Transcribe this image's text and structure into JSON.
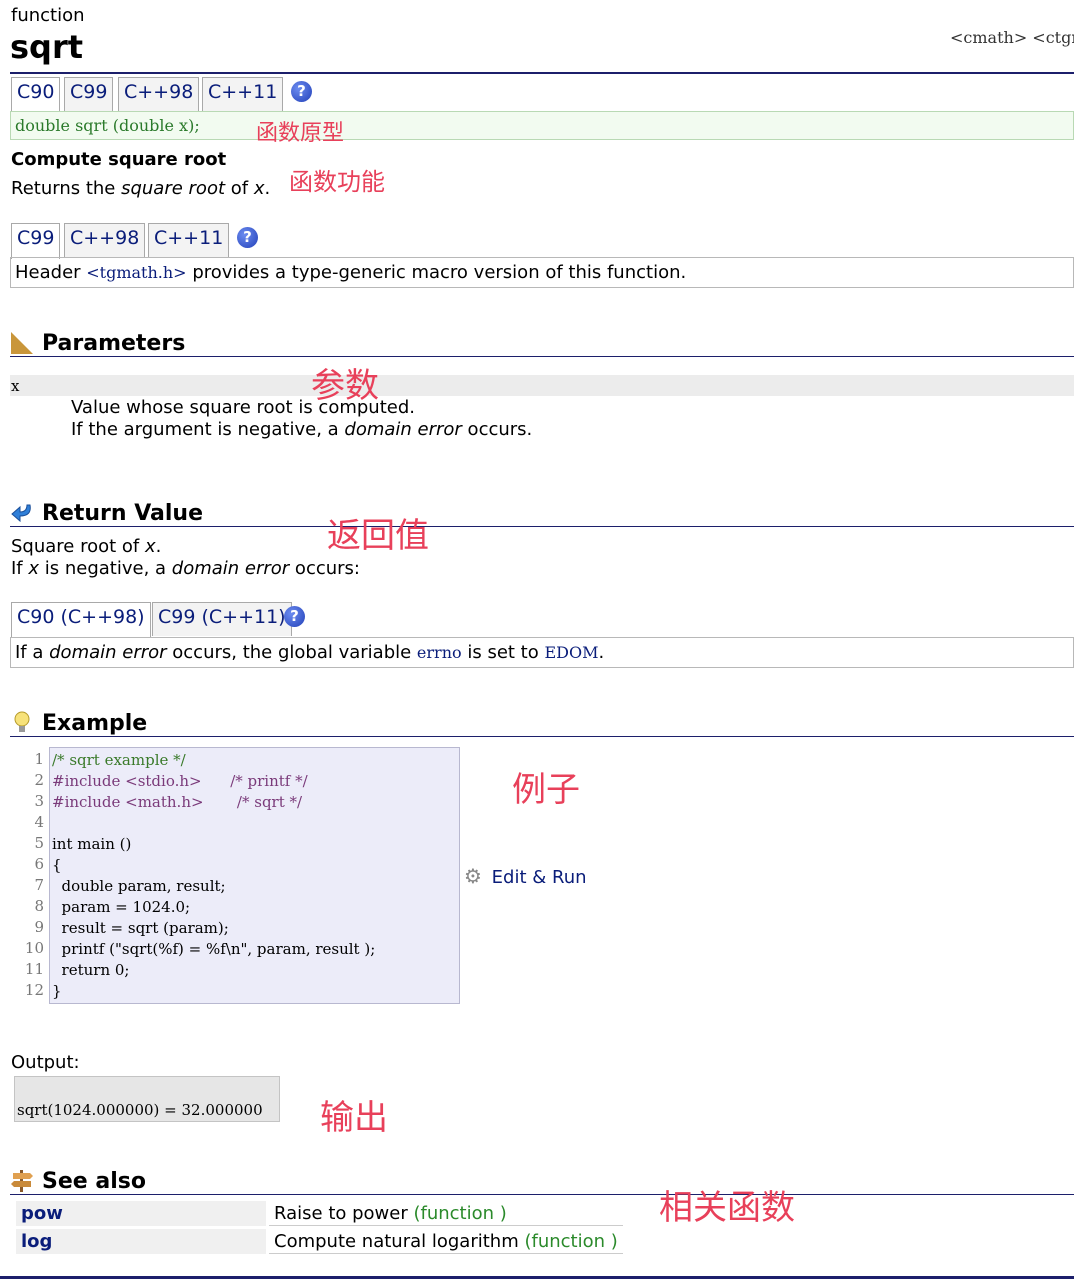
{
  "header": {
    "kind": "function",
    "name": "sqrt",
    "headers": "<cmath> <ctgma"
  },
  "proto_tabs": [
    "C90",
    "C99",
    "C++98",
    "C++11"
  ],
  "prototype": "double sqrt (double x);",
  "summary": {
    "title": "Compute square root",
    "text_pre": "Returns the ",
    "text_em": "square root",
    "text_mid": " of ",
    "text_var": "x",
    "text_post": "."
  },
  "generic_tabs": [
    "C99",
    "C++98",
    "C++11"
  ],
  "generic_note": {
    "pre": "Header ",
    "code": "<tgmath.h>",
    "post": " provides a type-generic macro version of this function."
  },
  "parameters": {
    "title": "Parameters",
    "param_name": "x",
    "line1": "Value whose square root is computed.",
    "line2_pre": "If the argument is negative, a ",
    "line2_em": "domain error",
    "line2_post": " occurs."
  },
  "return_value": {
    "title": "Return Value",
    "line1_pre": "Square root of ",
    "line1_var": "x",
    "line1_post": ".",
    "line2_a": "If ",
    "line2_var": "x",
    "line2_b": " is negative, a ",
    "line2_em": "domain error",
    "line2_c": " occurs:",
    "tabs": [
      "C90 (C++98)",
      "C99 (C++11)"
    ],
    "note_a": "If a ",
    "note_em": "domain error",
    "note_b": " occurs, the global variable ",
    "note_code1": "errno",
    "note_c": " is set to ",
    "note_code2": "EDOM",
    "note_d": "."
  },
  "example": {
    "title": "Example",
    "line_numbers": [
      "1",
      "2",
      "3",
      "4",
      "5",
      "6",
      "7",
      "8",
      "9",
      "10",
      "11",
      "12"
    ],
    "lines": [
      "/* sqrt example */",
      "#include <stdio.h>      /* printf */",
      "#include <math.h>       /* sqrt */",
      "",
      "int main ()",
      "{",
      "  double param, result;",
      "  param = 1024.0;",
      "  result = sqrt (param);",
      "  printf (\"sqrt(%f) = %f\\n\", param, result );",
      "  return 0;",
      "}"
    ],
    "edit_run": "Edit & Run",
    "output_label": "Output:",
    "output": "sqrt(1024.000000) = 32.000000"
  },
  "see_also": {
    "title": "See also",
    "rows": [
      {
        "name": "pow",
        "desc": "Raise to power",
        "kind": "(function )"
      },
      {
        "name": "log",
        "desc": "Compute natural logarithm",
        "kind": "(function )"
      }
    ]
  },
  "annotations": {
    "prototype": "函数原型",
    "function": "函数功能",
    "params": "参数",
    "return": "返回值",
    "example": "例子",
    "output": "输出",
    "related": "相关函数"
  },
  "colors": {
    "rule": "#1c1f6b",
    "annotation": "#e8405a",
    "link": "#0a1d7a"
  }
}
